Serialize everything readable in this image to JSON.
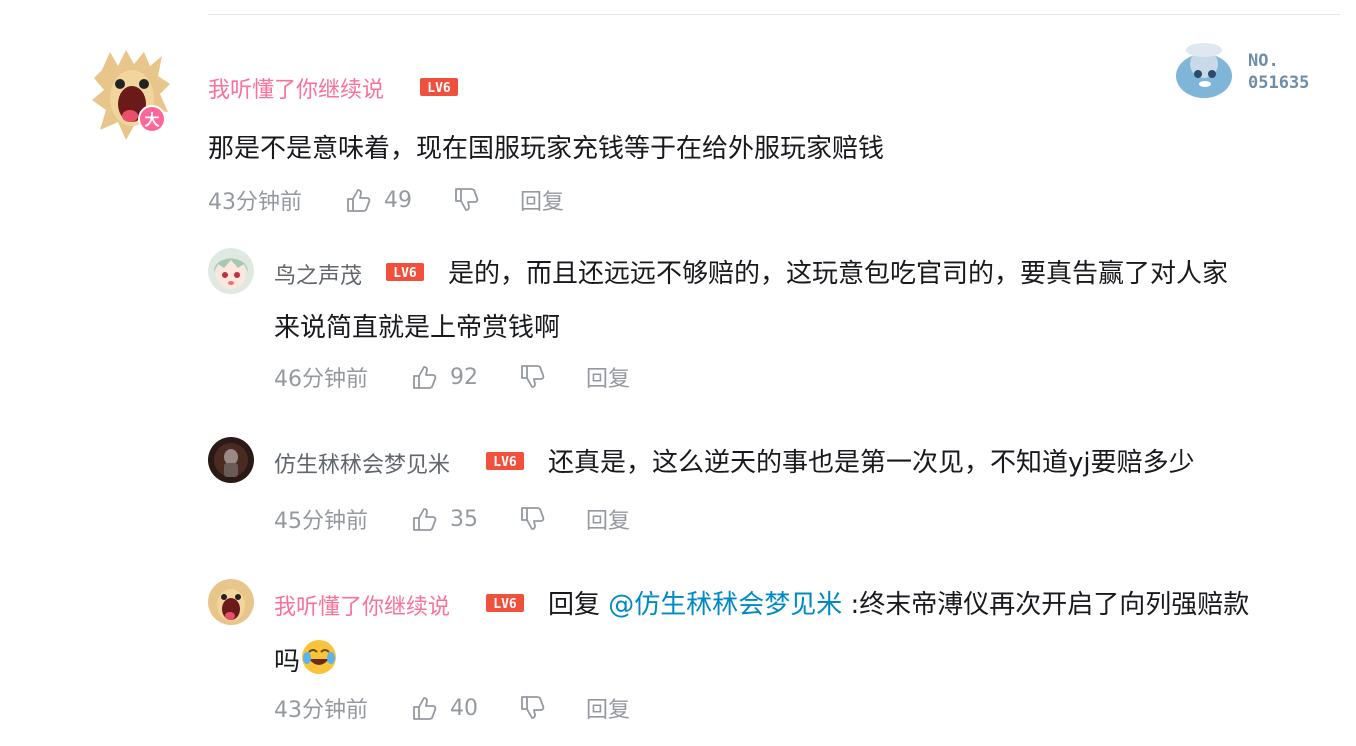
{
  "main_comment": {
    "username": "我听懂了你继续说",
    "level": "LV6",
    "badge": "大",
    "text": "那是不是意味着，现在国服玩家充钱等于在给外服玩家赔钱",
    "time": "43分钟前",
    "likes": "49",
    "reply_label": "回复",
    "fan_card": {
      "no_label": "NO.",
      "number": "051635"
    }
  },
  "replies": [
    {
      "username": "鸟之声茂",
      "level": "LV6",
      "text_line1": "是的，而且还远远不够赔的，这玩意包吃官司的，要真告赢了对人家",
      "text_line2": "来说简直就是上帝赏钱啊",
      "time": "46分钟前",
      "likes": "92",
      "reply_label": "回复"
    },
    {
      "username": "仿生秫秫会梦见米",
      "level": "LV6",
      "text_line1": "还真是，这么逆天的事也是第一次见，不知道yj要赔多少",
      "time": "45分钟前",
      "likes": "35",
      "reply_label": "回复"
    },
    {
      "username": "我听懂了你继续说",
      "level": "LV6",
      "reply_prefix": "回复 ",
      "mention": "@仿生秫秫会梦见米",
      "text_line1": " :终末帝溥仪再次开启了向列强赔款",
      "text_line2": "吗",
      "emoji": "laughing-crying-emoji",
      "time": "43分钟前",
      "likes": "40",
      "reply_label": "回复"
    }
  ],
  "colors": {
    "vip_pink": "#fb7299",
    "level_red": "#f0503c",
    "mention_blue": "#008ac5",
    "meta_gray": "#9499a0"
  }
}
